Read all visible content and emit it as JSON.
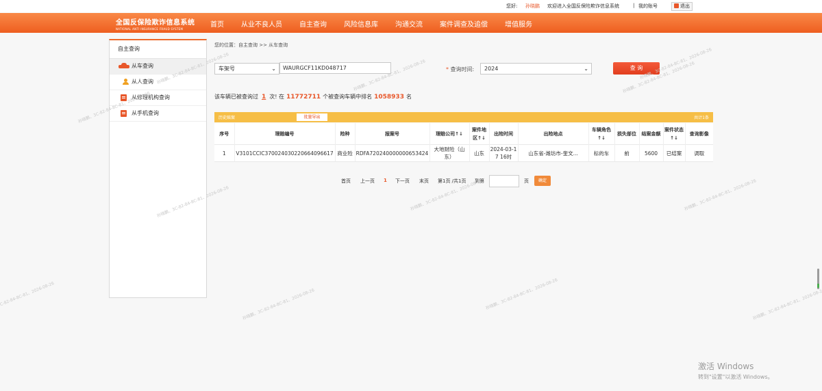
{
  "topbar": {
    "greeting": "您好:",
    "user": "孙晓鹏",
    "welcome": "欢迎进入全国反保险欺诈信息系统",
    "divider": "|",
    "account": "我的账号",
    "logout": "退出"
  },
  "header": {
    "logo_cn": "全国反保险欺诈信息系统",
    "logo_en": "NATIONAL ANTI INSURANCE FRAUD SYSTEM",
    "nav": [
      "首页",
      "从业不良人员",
      "自主查询",
      "风险信息库",
      "沟通交流",
      "案件调查及追偿",
      "增值服务"
    ]
  },
  "sidebar": {
    "title": "自主查询",
    "items": [
      {
        "label": "从车查询",
        "icon": "car-icon"
      },
      {
        "label": "从人查询",
        "icon": "person-icon"
      },
      {
        "label": "从修理机构查询",
        "icon": "document-icon"
      },
      {
        "label": "从手机查询",
        "icon": "document-icon"
      }
    ]
  },
  "breadcrumb": "您的位置：自主查询 >> 从车查询",
  "search": {
    "field_type": "车架号",
    "vin_value": "WAURGCF11KD048717",
    "required_mark": "*",
    "time_label": "查询时间:",
    "time_value": "2024",
    "query_button": "查 询"
  },
  "stats": {
    "p1": "该车辆已被查询过",
    "count": "1",
    "p2": "次! 在",
    "total": "11772711",
    "p3": "个被查询车辆中排名",
    "rank": "1058933",
    "p4": "名"
  },
  "history": {
    "title": "历史赔案",
    "export": "批量导出",
    "total": "共计1条"
  },
  "table": {
    "headers": [
      "序号",
      "理赔编号",
      "险种",
      "报案号",
      "理赔公司↑↓",
      "案件地区↑↓",
      "出险时间",
      "出险地点",
      "车辆角色↑↓",
      "损失部位",
      "结案金额",
      "案件状态↑↓",
      "查询影像"
    ],
    "rows": [
      [
        "1",
        "V3101CCIC370024030220664096617",
        "商业险",
        "RDFA720240000000653424",
        "大地财险（山东）",
        "山东",
        "2024-03-17 16时",
        "山东省-潍坊市-奎文...",
        "标的车",
        "前",
        "5600",
        "已结案",
        "调取"
      ]
    ]
  },
  "pager": {
    "first": "首页",
    "prev": "上一页",
    "current": "1",
    "next": "下一页",
    "last": "末页",
    "info": "第1页 /共1页",
    "goto": "到第",
    "page_unit": "页",
    "ok": "确定"
  },
  "watermark": "孙晓鹏、3C-82-84-8C-81、2026-08-26",
  "activation": {
    "line1": "激活 Windows",
    "line2": "转到\"设置\"以激活 Windows。"
  }
}
